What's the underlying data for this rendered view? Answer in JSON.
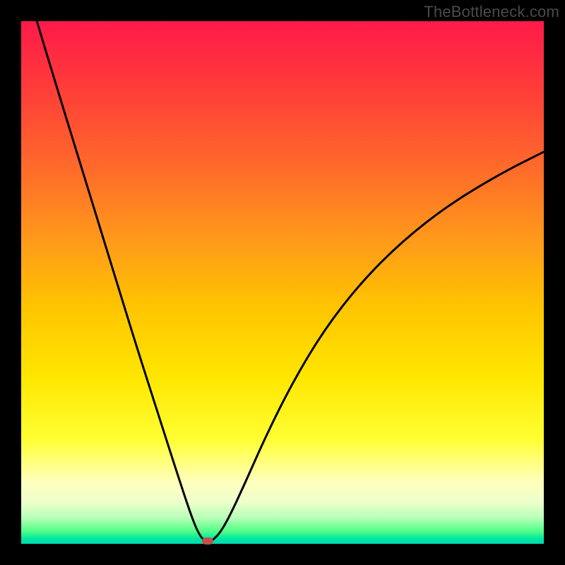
{
  "watermark": "TheBottleneck.com",
  "chart_data": {
    "type": "line",
    "title": "",
    "xlabel": "",
    "ylabel": "",
    "xlim": [
      0,
      100
    ],
    "ylim": [
      0,
      100
    ],
    "grid": false,
    "legend": false,
    "series": [
      {
        "name": "left-branch",
        "x": [
          3,
          6,
          10,
          14,
          18,
          22,
          26,
          30,
          33,
          34.5,
          35.5
        ],
        "y": [
          100,
          90,
          77,
          64,
          51,
          38,
          25.5,
          13,
          4,
          1,
          0.6
        ]
      },
      {
        "name": "right-branch",
        "x": [
          36.5,
          38,
          40,
          43,
          47,
          52,
          58,
          65,
          73,
          82,
          92,
          100
        ],
        "y": [
          0.6,
          2,
          5.5,
          12,
          21,
          31,
          41,
          50,
          58,
          65,
          71,
          75
        ]
      }
    ],
    "marker": {
      "x": 35.7,
      "y": 0.5,
      "color": "#c6514a"
    },
    "background_gradient": {
      "top": "#ff1a4a",
      "mid": "#ffe600",
      "bottom": "#00d8b0"
    }
  }
}
